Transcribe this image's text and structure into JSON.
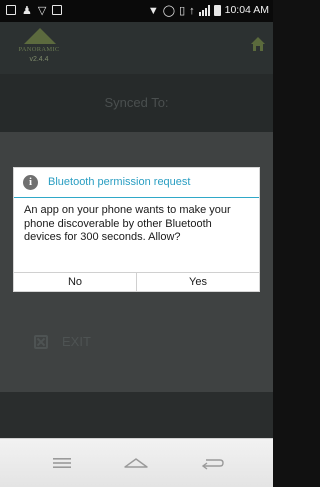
{
  "status_bar": {
    "time": "10:04 AM",
    "left_icons": [
      "screenshot-icon",
      "user-icon",
      "wifi-icon",
      "image-icon"
    ],
    "right_icons": [
      "location-icon",
      "alarm-icon",
      "vibrate-icon",
      "network-icon",
      "signal-icon",
      "battery-icon"
    ]
  },
  "app_header": {
    "brand": "PANORAMIC",
    "version": "v2.4.4",
    "home_icon": "home-icon"
  },
  "synced": {
    "label": "Synced To:"
  },
  "dialog": {
    "title": "Bluetooth permission request",
    "icon": "info-icon",
    "message": "An app on your phone wants to make your phone discoverable by other Bluetooth devices for 300 seconds. Allow?",
    "no_label": "No",
    "yes_label": "Yes"
  },
  "menu": {
    "exit_label": "EXIT"
  },
  "nav_bar": {
    "icons": [
      "menu-icon",
      "home-icon",
      "back-icon"
    ]
  },
  "colors": {
    "dialog_accent": "#2fa8c8",
    "dim_background": "#3f4242",
    "nav_bar": "#ececec"
  }
}
